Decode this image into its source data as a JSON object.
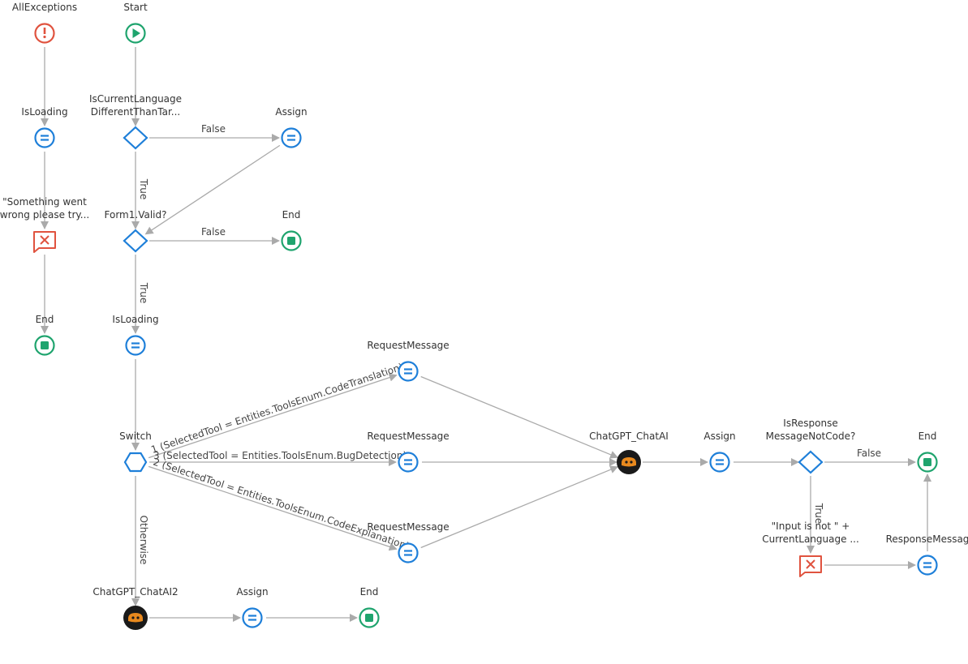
{
  "colors": {
    "assign": "#1e7fd9",
    "decision": "#1e7fd9",
    "end": "#1fa46e",
    "start": "#1fa46e",
    "exception": "#e0533f",
    "message": "#e0533f",
    "ai_bg": "#1a1a1a",
    "ai_fg": "#e8891e",
    "edge": "#aaaaaa"
  },
  "nodes": [
    {
      "id": "allexc",
      "type": "exception",
      "label": [
        "AllExceptions"
      ]
    },
    {
      "id": "isload1",
      "type": "assign",
      "label": [
        "IsLoading"
      ]
    },
    {
      "id": "errmsg",
      "type": "message",
      "label": [
        "\"Something went",
        "wrong please try..."
      ]
    },
    {
      "id": "end1",
      "type": "end",
      "label": [
        "End"
      ]
    },
    {
      "id": "start",
      "type": "start",
      "label": [
        "Start"
      ]
    },
    {
      "id": "if1",
      "type": "decision",
      "label": [
        "IsCurrentLanguage",
        "DifferentThanTar..."
      ]
    },
    {
      "id": "assign1",
      "type": "assign",
      "label": [
        "Assign"
      ]
    },
    {
      "id": "if2",
      "type": "decision",
      "label": [
        "Form1.Valid?"
      ]
    },
    {
      "id": "end2",
      "type": "end",
      "label": [
        "End"
      ]
    },
    {
      "id": "isload2",
      "type": "assign",
      "label": [
        "IsLoading"
      ]
    },
    {
      "id": "switch",
      "type": "switch",
      "label": [
        "Switch"
      ]
    },
    {
      "id": "rm1",
      "type": "assign",
      "label": [
        "RequestMessage"
      ]
    },
    {
      "id": "rm2",
      "type": "assign",
      "label": [
        "RequestMessage"
      ]
    },
    {
      "id": "rm3",
      "type": "assign",
      "label": [
        "RequestMessage"
      ]
    },
    {
      "id": "chat1",
      "type": "ai",
      "label": [
        "ChatGPT_ChatAI"
      ]
    },
    {
      "id": "assign2",
      "type": "assign",
      "label": [
        "Assign"
      ]
    },
    {
      "id": "if3",
      "type": "decision",
      "label": [
        "IsResponse",
        "MessageNotCode?"
      ]
    },
    {
      "id": "end3",
      "type": "end",
      "label": [
        "End"
      ]
    },
    {
      "id": "msg2",
      "type": "message",
      "label": [
        "\"Input is not \" +",
        "CurrentLanguage ..."
      ]
    },
    {
      "id": "respmsg",
      "type": "assign",
      "label": [
        "ResponseMessag"
      ]
    },
    {
      "id": "chat2",
      "type": "ai",
      "label": [
        "ChatGPT_ChatAI2"
      ]
    },
    {
      "id": "assign3",
      "type": "assign",
      "label": [
        "Assign"
      ]
    },
    {
      "id": "end4",
      "type": "end",
      "label": [
        "End"
      ]
    }
  ],
  "edges": [
    {
      "from": "allexc",
      "to": "isload1",
      "label": ""
    },
    {
      "from": "isload1",
      "to": "errmsg",
      "label": ""
    },
    {
      "from": "errmsg",
      "to": "end1",
      "label": ""
    },
    {
      "from": "start",
      "to": "if1",
      "label": ""
    },
    {
      "from": "if1",
      "to": "assign1",
      "label": "False"
    },
    {
      "from": "if1",
      "to": "if2",
      "label": "True"
    },
    {
      "from": "assign1",
      "to": "if2",
      "label": ""
    },
    {
      "from": "if2",
      "to": "end2",
      "label": "False"
    },
    {
      "from": "if2",
      "to": "isload2",
      "label": "True"
    },
    {
      "from": "isload2",
      "to": "switch",
      "label": ""
    },
    {
      "from": "switch",
      "to": "rm1",
      "label": "1 (SelectedTool = Entities.ToolsEnum.CodeTranslation)"
    },
    {
      "from": "switch",
      "to": "rm2",
      "label": "3 (SelectedTool = Entities.ToolsEnum.BugDetection)"
    },
    {
      "from": "switch",
      "to": "rm3",
      "label": "2 (SelectedTool = Entities.ToolsEnum.CodeExplanation)"
    },
    {
      "from": "switch",
      "to": "chat2",
      "label": "Otherwise"
    },
    {
      "from": "rm1",
      "to": "chat1",
      "label": ""
    },
    {
      "from": "rm2",
      "to": "chat1",
      "label": ""
    },
    {
      "from": "rm3",
      "to": "chat1",
      "label": ""
    },
    {
      "from": "chat1",
      "to": "assign2",
      "label": ""
    },
    {
      "from": "assign2",
      "to": "if3",
      "label": ""
    },
    {
      "from": "if3",
      "to": "end3",
      "label": "False"
    },
    {
      "from": "if3",
      "to": "msg2",
      "label": "True"
    },
    {
      "from": "msg2",
      "to": "respmsg",
      "label": ""
    },
    {
      "from": "respmsg",
      "to": "end3",
      "label": ""
    },
    {
      "from": "chat2",
      "to": "assign3",
      "label": ""
    },
    {
      "from": "assign3",
      "to": "end4",
      "label": ""
    }
  ]
}
